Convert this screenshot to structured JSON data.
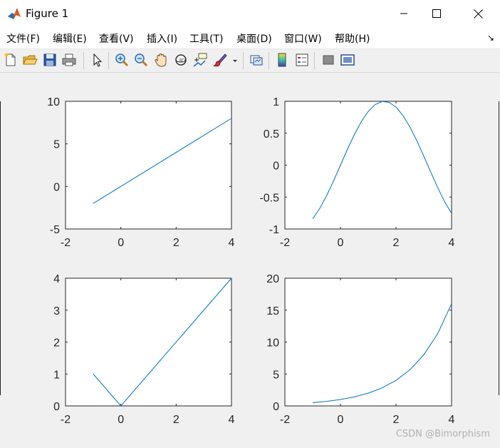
{
  "window": {
    "title": "Figure 1",
    "minimize_glyph": "—",
    "maximize_glyph": "☐",
    "close_glyph": "✕"
  },
  "menu": {
    "items": [
      "文件(F)",
      "编辑(E)",
      "查看(V)",
      "插入(I)",
      "工具(T)",
      "桌面(D)",
      "窗口(W)",
      "帮助(H)"
    ],
    "overflow_glyph": "↘"
  },
  "toolbar": {
    "buttons": [
      "new-figure-icon",
      "open-file-icon",
      "save-icon",
      "print-icon",
      "pointer-icon",
      "zoom-in-icon",
      "zoom-out-icon",
      "pan-hand-icon",
      "rotate-3d-icon",
      "data-cursor-icon",
      "brush-icon",
      "brush-dropdown-icon",
      "link-plot-icon",
      "colorbar-icon",
      "legend-icon",
      "hide-plot-tools-icon",
      "show-plot-tools-icon"
    ]
  },
  "watermark": "CSDN @Bimorphism",
  "colors": {
    "line": "#0072bd",
    "axes_bg": "#ffffff",
    "figure_bg": "#f0f0f0"
  },
  "chart_data": [
    {
      "type": "line",
      "title": "",
      "xlabel": "",
      "ylabel": "",
      "xlim": [
        -2,
        4
      ],
      "ylim": [
        -5,
        10
      ],
      "xticks": [
        -2,
        0,
        2,
        4
      ],
      "yticks": [
        -5,
        0,
        5,
        10
      ],
      "xticklabels": [
        "-2",
        "0",
        "2",
        "4"
      ],
      "yticklabels": [
        "-5",
        "0",
        "5",
        "10"
      ],
      "series": [
        {
          "x": [
            -1,
            4
          ],
          "y": [
            -2,
            8
          ]
        }
      ]
    },
    {
      "type": "line",
      "title": "",
      "xlabel": "",
      "ylabel": "",
      "xlim": [
        -2,
        4
      ],
      "ylim": [
        -1,
        1
      ],
      "xticks": [
        -2,
        0,
        2,
        4
      ],
      "yticks": [
        -1,
        -0.5,
        0,
        0.5,
        1
      ],
      "xticklabels": [
        "-2",
        "0",
        "2",
        "4"
      ],
      "yticklabels": [
        "-1",
        "-0.5",
        "0",
        "0.5",
        "1"
      ],
      "series": [
        {
          "x": [
            -1,
            -0.75,
            -0.5,
            -0.25,
            0,
            0.25,
            0.5,
            0.75,
            1,
            1.25,
            1.5,
            1.75,
            2,
            2.25,
            2.5,
            2.75,
            3,
            3.25,
            3.5,
            3.75,
            4
          ],
          "y": [
            -0.841,
            -0.682,
            -0.479,
            -0.247,
            0,
            0.247,
            0.479,
            0.682,
            0.841,
            0.949,
            0.997,
            0.984,
            0.909,
            0.778,
            0.598,
            0.382,
            0.141,
            -0.108,
            -0.351,
            -0.572,
            -0.757
          ]
        }
      ]
    },
    {
      "type": "line",
      "title": "",
      "xlabel": "",
      "ylabel": "",
      "xlim": [
        -2,
        4
      ],
      "ylim": [
        0,
        4
      ],
      "xticks": [
        -2,
        0,
        2,
        4
      ],
      "yticks": [
        0,
        1,
        2,
        3,
        4
      ],
      "xticklabels": [
        "-2",
        "0",
        "2",
        "4"
      ],
      "yticklabels": [
        "0",
        "1",
        "2",
        "3",
        "4"
      ],
      "series": [
        {
          "x": [
            -1,
            0,
            4
          ],
          "y": [
            1,
            0,
            4
          ]
        }
      ]
    },
    {
      "type": "line",
      "title": "",
      "xlabel": "",
      "ylabel": "",
      "xlim": [
        -2,
        4
      ],
      "ylim": [
        0,
        20
      ],
      "xticks": [
        -2,
        0,
        2,
        4
      ],
      "yticks": [
        0,
        5,
        10,
        15,
        20
      ],
      "xticklabels": [
        "-2",
        "0",
        "2",
        "4"
      ],
      "yticklabels": [
        "0",
        "5",
        "10",
        "15",
        "20"
      ],
      "series": [
        {
          "x": [
            -1,
            -0.5,
            0,
            0.5,
            1,
            1.5,
            2,
            2.5,
            3,
            3.5,
            4
          ],
          "y": [
            0.5,
            0.707,
            1,
            1.414,
            2,
            2.828,
            4,
            5.657,
            8,
            11.314,
            16
          ]
        }
      ]
    }
  ]
}
